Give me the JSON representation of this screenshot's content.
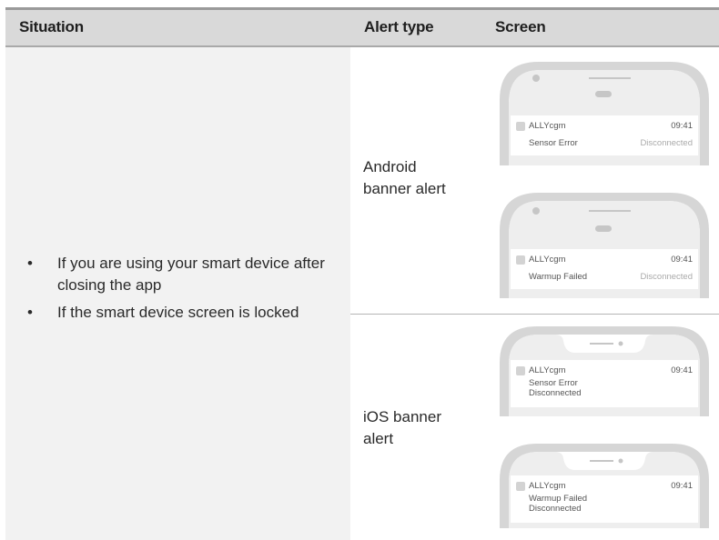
{
  "table": {
    "headers": {
      "situation": "Situation",
      "alert_type": "Alert type",
      "screen": "Screen"
    },
    "situations": [
      "If you are using your smart device after closing the app",
      "If the smart device screen is locked"
    ],
    "bullet": "•",
    "rows": [
      {
        "alert_type_lines": [
          "Android",
          "banner alert"
        ],
        "screens": [
          {
            "app": "ALLYcgm",
            "time": "09:41",
            "message": "Sensor Error",
            "status": "Disconnected"
          },
          {
            "app": "ALLYcgm",
            "time": "09:41",
            "message": "Warmup Failed",
            "status": "Disconnected"
          }
        ]
      },
      {
        "alert_type_lines": [
          "iOS banner",
          "alert"
        ],
        "screens": [
          {
            "app": "ALLYcgm",
            "time": "09:41",
            "message": "Sensor Error",
            "status": "Disconnected"
          },
          {
            "app": "ALLYcgm",
            "time": "09:41",
            "message": "Warmup Failed",
            "status": "Disconnected"
          }
        ]
      }
    ]
  },
  "colors": {
    "header_bg": "#d9d9d9",
    "situation_bg": "#f2f2f2",
    "phone_frame": "#d6d6d6",
    "notification_bg": "#ffffff",
    "app_icon": "#d3d3d3"
  }
}
